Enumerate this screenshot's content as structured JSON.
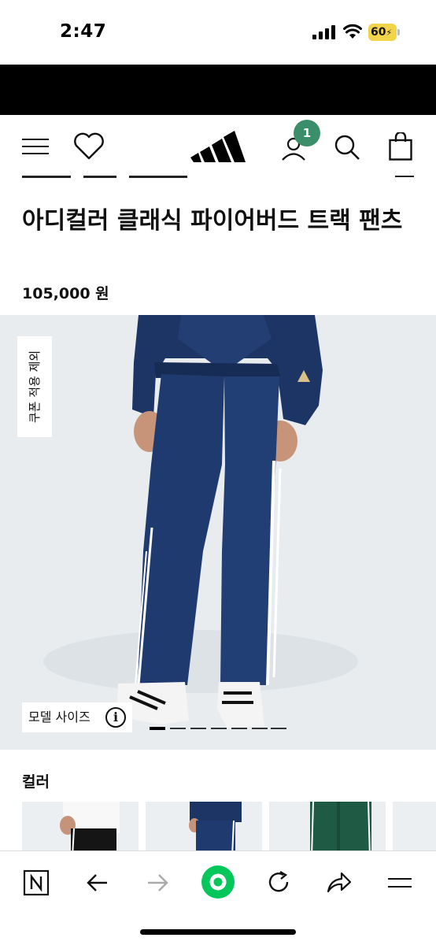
{
  "status_bar": {
    "time": "2:47",
    "battery": "60"
  },
  "header": {
    "cart_badge": "1"
  },
  "product": {
    "title": "아디컬러 클래식 파이어버드 트랙 팬츠",
    "price": "105,000 원"
  },
  "hero": {
    "coupon_tag": "쿠폰 적용 제외",
    "model_size_label": "모델 사이즈",
    "info_symbol": "i",
    "slide_count": 7,
    "active_slide": 1
  },
  "colors": {
    "label": "컬러",
    "swatches": [
      "black",
      "navy",
      "green",
      "gray"
    ]
  },
  "theme": {
    "navy": "#1f3a6e",
    "badge_green": "#3a8f6a",
    "battery_yellow": "#f2d44a",
    "naver_green": "#03c75a"
  }
}
